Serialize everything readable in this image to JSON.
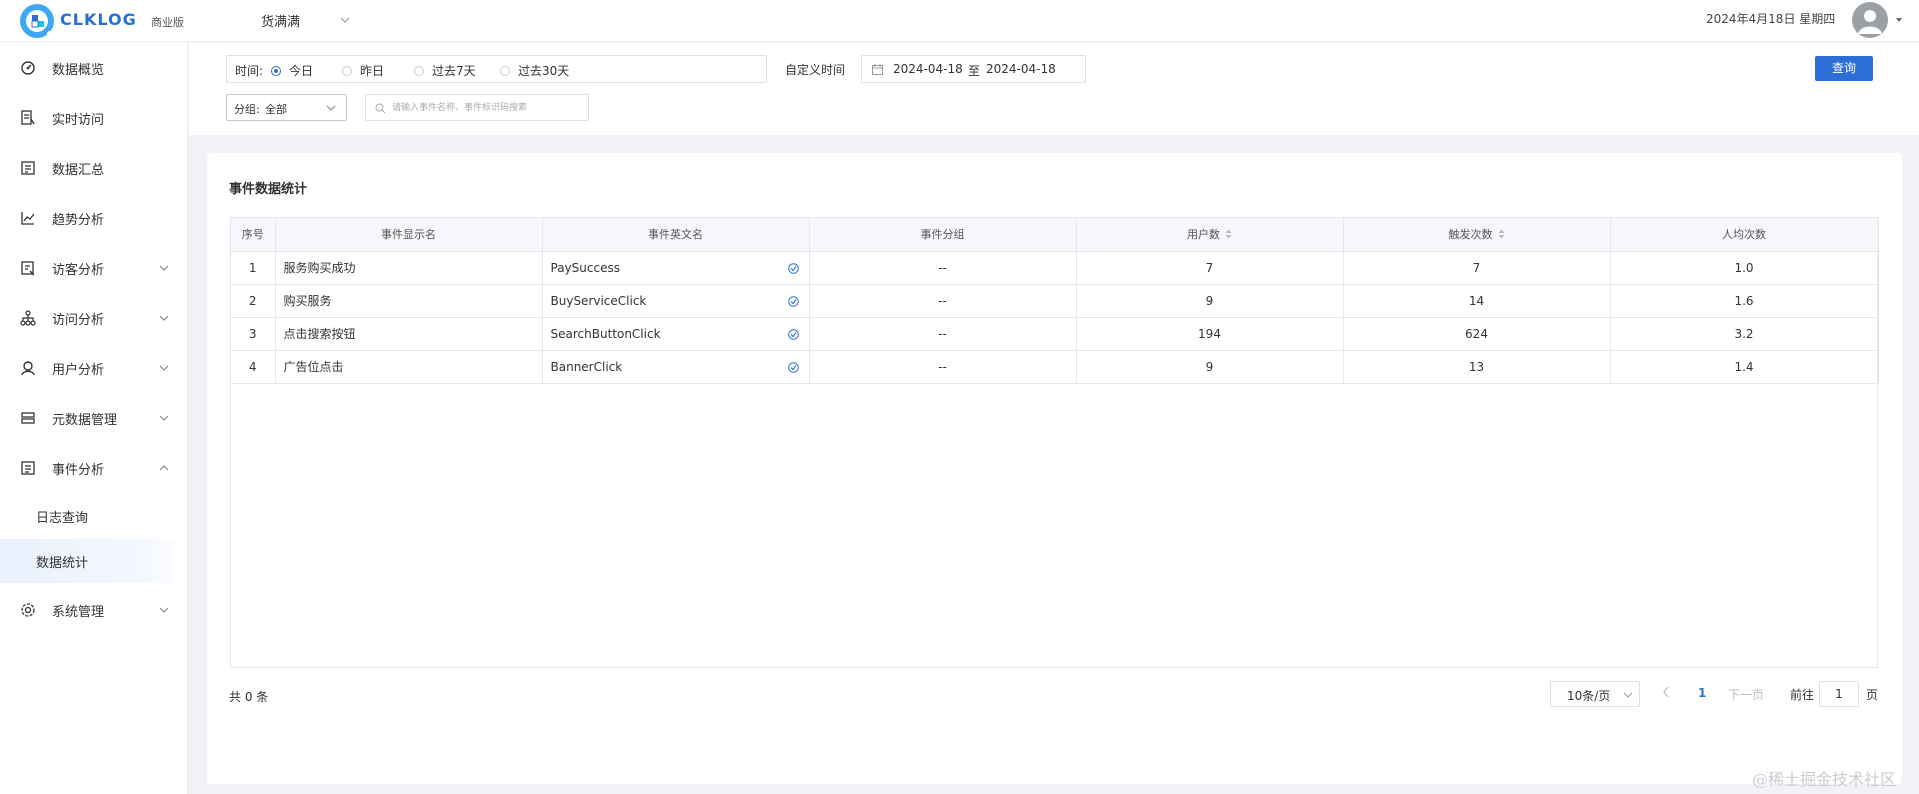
{
  "header": {
    "brand": "CLKLOG",
    "edition": "商业版",
    "project": "货满满",
    "date": "2024年4月18日 星期四"
  },
  "sidebar": {
    "items": [
      {
        "label": "数据概览",
        "icon": "dashboard-icon"
      },
      {
        "label": "实时访问",
        "icon": "realtime-icon"
      },
      {
        "label": "数据汇总",
        "icon": "summary-icon"
      },
      {
        "label": "趋势分析",
        "icon": "trend-icon"
      },
      {
        "label": "访客分析",
        "icon": "visitor-icon"
      },
      {
        "label": "访问分析",
        "icon": "access-icon"
      },
      {
        "label": "用户分析",
        "icon": "user-icon"
      },
      {
        "label": "元数据管理",
        "icon": "metadata-icon"
      },
      {
        "label": "事件分析",
        "icon": "event-icon"
      },
      {
        "label": "日志查询"
      },
      {
        "label": "数据统计"
      },
      {
        "label": "系统管理",
        "icon": "settings-icon"
      }
    ]
  },
  "filters": {
    "time_label": "时间:",
    "options": [
      "今日",
      "昨日",
      "过去7天",
      "过去30天"
    ],
    "selected": "今日",
    "custom_time_label": "自定义时间",
    "date_start": "2024-04-18",
    "date_sep": "至",
    "date_end": "2024-04-18",
    "query_label": "查询",
    "group_label": "分组:",
    "group_value": "全部",
    "search_placeholder": "请输入事件名称、事件标识码搜索"
  },
  "card": {
    "title": "事件数据统计"
  },
  "table": {
    "columns": [
      "序号",
      "事件显示名",
      "事件英文名",
      "事件分组",
      "用户数",
      "触发次数",
      "人均次数"
    ],
    "rows": [
      {
        "no": "1",
        "name": "服务购买成功",
        "en": "PaySuccess",
        "group": "--",
        "users": "7",
        "triggers": "7",
        "avg": "1.0"
      },
      {
        "no": "2",
        "name": "购买服务",
        "en": "BuyServiceClick",
        "group": "--",
        "users": "9",
        "triggers": "14",
        "avg": "1.6"
      },
      {
        "no": "3",
        "name": "点击搜索按钮",
        "en": "SearchButtonClick",
        "group": "--",
        "users": "194",
        "triggers": "624",
        "avg": "3.2"
      },
      {
        "no": "4",
        "name": "广告位点击",
        "en": "BannerClick",
        "group": "--",
        "users": "9",
        "triggers": "13",
        "avg": "1.4"
      }
    ]
  },
  "pagination": {
    "total": "共 0 条",
    "page_size": "10条/页",
    "current_page": "1",
    "next_label": "下一页",
    "goto_pre": "前往",
    "goto_value": "1",
    "goto_post": "页"
  },
  "watermark": "@稀土掘金技术社区",
  "colors": {
    "accent": "#2b6fd6",
    "header_bg": "#ffffff",
    "page_bg": "#f0f2f7",
    "table_header_bg": "#f5f7fa"
  }
}
